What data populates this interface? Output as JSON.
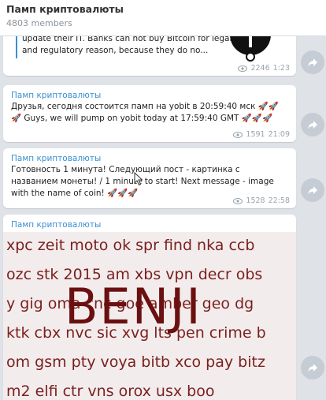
{
  "channel": {
    "title": "Памп криптовалюты",
    "members": "4803 members"
  },
  "messages": [
    {
      "text": "update their IT.  Banks can not buy Bitcoin for legal and regulatory reason, because they do no...",
      "views": "2246",
      "time": "1:23"
    },
    {
      "sender": "Памп криптовалюты",
      "text": "Друзья, сегодня состоится памп на yobit в 20:59:40 мск 🚀🚀🚀 Guys, we will pump on yobit today at 17:59:40 GMT 🚀🚀🚀",
      "views": "1591",
      "time": "21:09"
    },
    {
      "sender": "Памп криптовалюты",
      "text": "Готовность 1 минута! Следующий пост - картинка с названием монеты! / 1 minute to start! Next message - image with the name of coin! 🚀🚀🚀",
      "views": "1528",
      "time": "22:58"
    },
    {
      "sender": "Памп криптовалюты",
      "poster": {
        "lines": [
          "xpc zeit moto ok spr find nka ccb",
          "ozc stk 2015 am xbs vpn decr obs",
          "y gig oma cnc goe amber geo dg",
          "ktk cbx nvc sic xvg lts pen crime b",
          "om gsm pty voya bitb xco pay bitz",
          "m2 elfi ctr vns orox usx boo"
        ],
        "coin": "BENJI"
      }
    }
  ],
  "colors": {
    "accent": "#3a8fd0",
    "poster_text": "#7a1f1f"
  },
  "icons": [
    "eye-icon",
    "share-icon",
    "channel-logo-icon",
    "mouse-cursor-icon"
  ]
}
